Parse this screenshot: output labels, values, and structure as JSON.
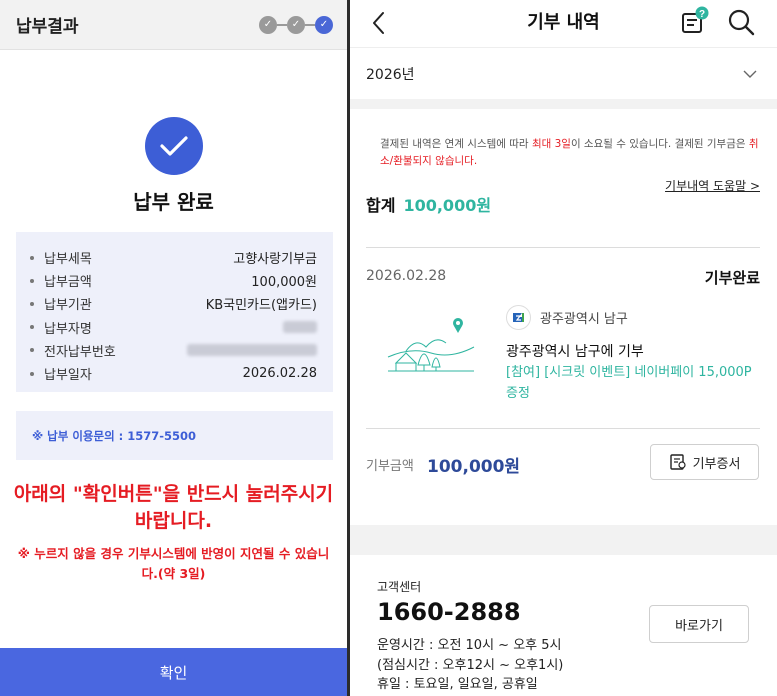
{
  "left": {
    "header_title": "납부결과",
    "done_title": "납부 완료",
    "info_rows": [
      {
        "label": "납부세목",
        "value": "고향사랑기부금"
      },
      {
        "label": "납부금액",
        "value": "100,000원"
      },
      {
        "label": "납부기관",
        "value": "KB국민카드(앱카드)"
      },
      {
        "label": "납부자명",
        "value": ""
      },
      {
        "label": "전자납부번호",
        "value": ""
      },
      {
        "label": "납부일자",
        "value": "2026.02.28"
      }
    ],
    "inquiry": "※ 납부 이용문의 : 1577-5500",
    "warning_main": "아래의 \"확인버튼\"을 반드시 눌러주시기 바랍니다.",
    "warning_sub": "※ 누르지 않을 경우 기부시스템에 반영이 지연될 수 있습니다.(약 3일)",
    "confirm_label": "확인",
    "colors": {
      "accent": "#4a67e0",
      "warning": "#e51c23"
    }
  },
  "right": {
    "title": "기부 내역",
    "year": "2026년",
    "notice_part1": "결제된 내역은 연계 시스템에 따라 ",
    "notice_red1": "최대 3일",
    "notice_part2": "이 소요될 수 있습니다. 결제된 기부금은 ",
    "notice_red2": "취소/환불되지 않습니다.",
    "help_link": "기부내역 도움말 >",
    "total_label": "합계",
    "total_amount": "100,000원",
    "record": {
      "date": "2026.02.28",
      "status": "기부완료",
      "org": "광주광역시 남구",
      "title": "광주광역시 남구에 기부",
      "event": "[참여] [시크릿 이벤트] 네이버페이 15,000P 증정",
      "amount_label": "기부금액",
      "amount": "100,000원",
      "cert_label": "기부증서"
    },
    "customer_center": {
      "title": "고객센터",
      "phone": "1660-2888",
      "hours1": "운영시간 : 오전 10시 ~ 오후 5시",
      "hours2": "(점심시간 : 오후12시 ~ 오후1시)",
      "hours3": "휴일 : 토요일, 일요일, 공휴일",
      "go_label": "바로가기"
    },
    "colors": {
      "teal": "#2fb5a0",
      "navy": "#2e4a99"
    }
  }
}
